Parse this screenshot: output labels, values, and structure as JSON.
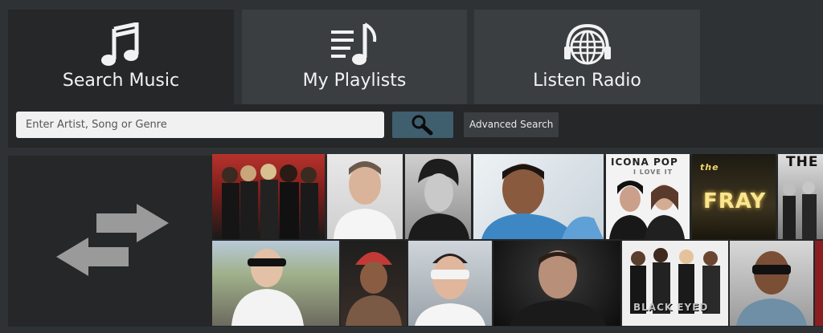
{
  "tabs": [
    {
      "label": "Search Music",
      "icon": "music-note-icon",
      "active": true
    },
    {
      "label": "My Playlists",
      "icon": "playlist-icon",
      "active": false
    },
    {
      "label": "Listen Radio",
      "icon": "globe-headphones-icon",
      "active": false
    }
  ],
  "search": {
    "placeholder": "Enter Artist, Song or Genre",
    "button_icon": "search-icon",
    "advanced_label": "Advanced Search"
  },
  "swap_icon": "swap-arrows-icon",
  "artist_tiles": {
    "row1": [
      "band-photo-1",
      "artist-photo-2",
      "artist-photo-3",
      "artist-photo-4",
      "icona-pop",
      "the-fray",
      "the-band"
    ],
    "row2": [
      "artist-photo-8",
      "artist-photo-9",
      "artist-photo-10",
      "artist-photo-11",
      "black-eyed-peas",
      "artist-photo-13"
    ]
  },
  "tile_text": {
    "icona_pop": "ICONA POP",
    "icona_pop_sub": "I LOVE IT",
    "the_fray": "FRAY",
    "the_fray_prefix": "the",
    "the_band": "THE",
    "black_eyed": "BLACK EYED"
  },
  "colors": {
    "background": "#2e3235",
    "panel": "#252728",
    "tab_inactive": "#3a3e41",
    "search_button": "#3f5e6e"
  }
}
